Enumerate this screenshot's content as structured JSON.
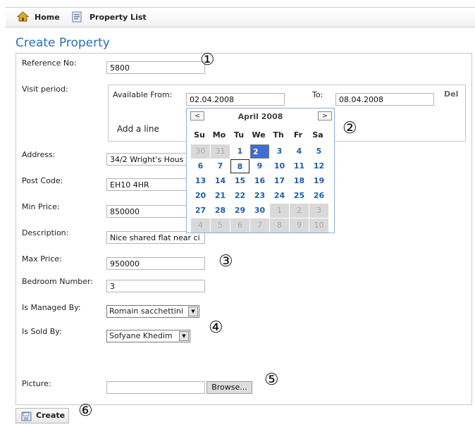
{
  "nav": {
    "home_label": "Home",
    "property_list_label": "Property List"
  },
  "page_title": "Create Property",
  "form": {
    "reference_no": {
      "label": "Reference No:",
      "value": "5800"
    },
    "visit_period": {
      "label": "Visit period:",
      "available_from_label": "Available From:",
      "available_from_value": "02.04.2008",
      "to_label": "To:",
      "to_value": "08.04.2008",
      "delete_label": "Del",
      "add_line_label": "Add a line"
    },
    "address": {
      "label": "Address:",
      "value": "34/2 Wright's Hous"
    },
    "post_code": {
      "label": "Post Code:",
      "value": "EH10 4HR"
    },
    "min_price": {
      "label": "Min Price:",
      "value": "850000"
    },
    "description": {
      "label": "Description:",
      "value": "Nice shared flat near ci"
    },
    "max_price": {
      "label": "Max Price:",
      "value": "950000"
    },
    "bedroom_number": {
      "label": "Bedroom Number:",
      "value": "3"
    },
    "is_managed_by": {
      "label": "Is Managed By:",
      "value": "Romain sacchettini"
    },
    "is_sold_by": {
      "label": "Is Sold By:",
      "value": "Sofyane Khedim"
    },
    "picture": {
      "label": "Picture:",
      "value": "",
      "browse_label": "Browse..."
    },
    "create_label": "Create"
  },
  "calendar": {
    "title": "April 2008",
    "prev": "<",
    "next": ">",
    "weekdays": [
      "Su",
      "Mo",
      "Tu",
      "We",
      "Th",
      "Fr",
      "Sa"
    ],
    "weeks": [
      [
        "30",
        "31",
        "1",
        "2",
        "3",
        "4",
        "5"
      ],
      [
        "6",
        "7",
        "8",
        "9",
        "10",
        "11",
        "12"
      ],
      [
        "13",
        "14",
        "15",
        "16",
        "17",
        "18",
        "19"
      ],
      [
        "20",
        "21",
        "22",
        "23",
        "24",
        "25",
        "26"
      ],
      [
        "27",
        "28",
        "29",
        "30",
        "1",
        "2",
        "3"
      ],
      [
        "4",
        "5",
        "6",
        "7",
        "8",
        "9",
        "10"
      ]
    ],
    "selected_day": "2",
    "today_day": "8"
  },
  "annotations": [
    "①",
    "②",
    "③",
    "④",
    "⑤",
    "⑥"
  ],
  "colors": {
    "title": "#2a6fb4",
    "calendar_day": "#1f5fa8",
    "calendar_selected": "#3d6ed1"
  }
}
